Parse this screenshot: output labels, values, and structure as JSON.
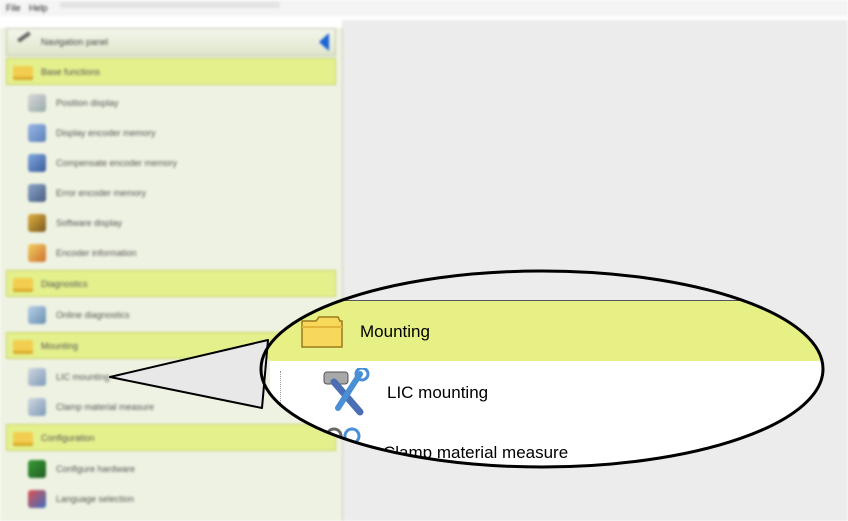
{
  "menubar": {
    "file": "File",
    "help": "Help"
  },
  "sidebar": {
    "header_label": "Navigation panel",
    "groups": [
      {
        "label": "Base functions",
        "items": [
          "Position display",
          "Display encoder memory",
          "Compensate encoder memory",
          "Error encoder memory",
          "Software display",
          "Encoder information"
        ]
      },
      {
        "label": "Diagnostics",
        "items": [
          "Online diagnostics"
        ]
      },
      {
        "label": "Mounting",
        "items": [
          "LIC mounting",
          "Clamp material measure"
        ]
      },
      {
        "label": "Configuration",
        "items": [
          "Configure hardware",
          "Language selection"
        ]
      }
    ]
  },
  "magnifier": {
    "group_label": "Mounting",
    "items": [
      "LIC mounting",
      "Clamp material measure"
    ]
  },
  "colors": {
    "group_bg": "#e6f084",
    "sidebar_bg": "#eef2e2",
    "accent": "#1b63d6"
  }
}
